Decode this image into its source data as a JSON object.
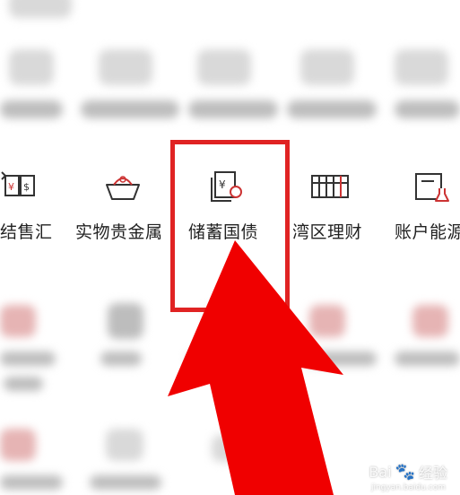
{
  "func_row": {
    "items": [
      {
        "label": "结售汇",
        "icon": "currency-exchange-icon"
      },
      {
        "label": "实物贵金属",
        "icon": "gold-bowl-icon"
      },
      {
        "label": "储蓄国债",
        "icon": "savings-bond-icon"
      },
      {
        "label": "湾区理财",
        "icon": "abacus-icon"
      },
      {
        "label": "账户能源",
        "icon": "account-flask-icon"
      }
    ]
  },
  "annotation": {
    "highlight_color": "#e02323",
    "highlighted_item": "储蓄国债"
  },
  "watermark": {
    "brand_left": "Bai",
    "brand_right": "经验",
    "sub": "jingyan.baidu.com"
  }
}
